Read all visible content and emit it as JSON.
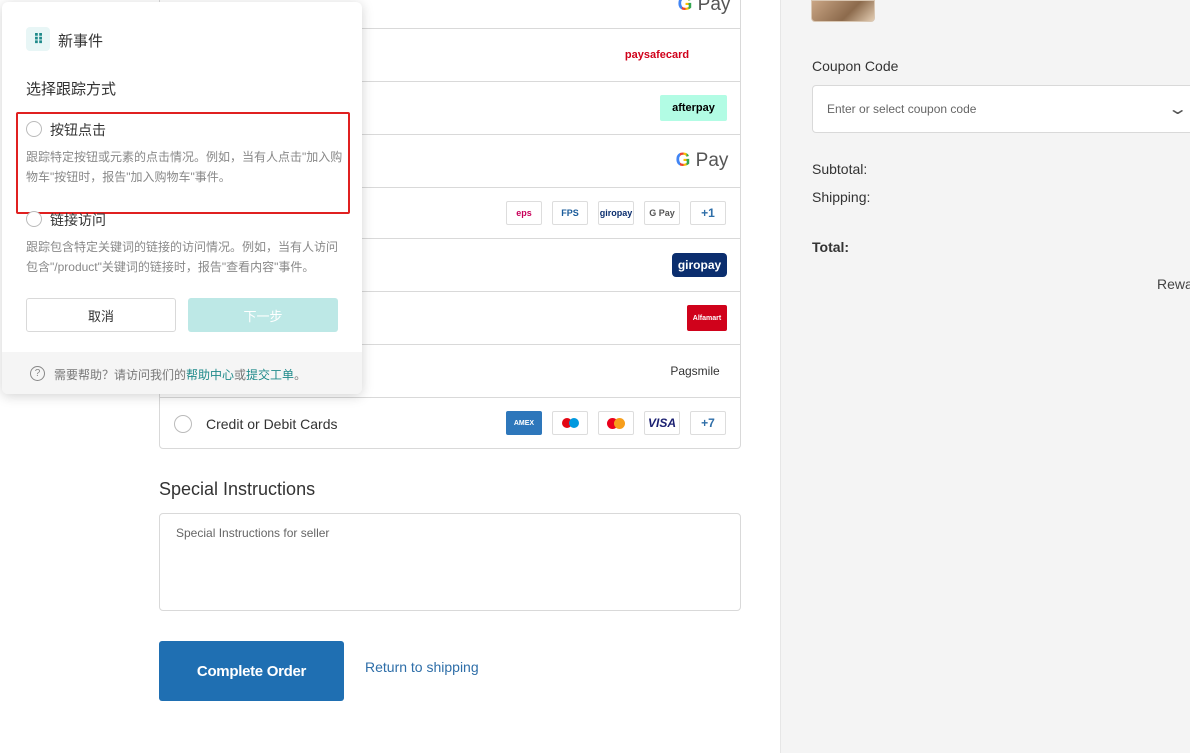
{
  "payment": {
    "methods": [
      {
        "label": "",
        "logo": "Pay"
      },
      {
        "label": "",
        "logo": "paysafecard"
      },
      {
        "label": "",
        "logo": "afterpay"
      },
      {
        "label": "",
        "logo": "Pay"
      },
      {
        "label": "",
        "logos": [
          "eps",
          "FPS",
          "giropay",
          "G Pay"
        ],
        "more": "+1"
      },
      {
        "label": "",
        "logo": "giropay"
      },
      {
        "label": "",
        "logo": "Alfamart"
      },
      {
        "label": "",
        "logo": "Pagsmile"
      },
      {
        "label": "Credit or Debit Cards",
        "logos": [
          "AMEX",
          "maestro",
          "mastercard",
          "VISA"
        ],
        "more": "+7"
      }
    ]
  },
  "special_instructions": {
    "title": "Special Instructions",
    "placeholder": "Special Instructions for seller"
  },
  "actions": {
    "complete_order": "Complete Order",
    "return_link": "Return to shipping"
  },
  "summary": {
    "coupon_label": "Coupon Code",
    "coupon_placeholder": "Enter or select coupon code",
    "subtotal_label": "Subtotal:",
    "shipping_label": "Shipping:",
    "total_label": "Total:",
    "reward_label": "Rewa"
  },
  "popup": {
    "title": "新事件",
    "section_title": "选择跟踪方式",
    "options": [
      {
        "label": "按钮点击",
        "desc": "跟踪特定按钮或元素的点击情况。例如，当有人点击\"加入购物车\"按钮时，报告\"加入购物车\"事件。"
      },
      {
        "label": "链接访问",
        "desc": "跟踪包含特定关键词的链接的访问情况。例如，当有人访问包含\"/product\"关键词的链接时，报告\"查看内容\"事件。"
      }
    ],
    "cancel": "取消",
    "next": "下一步",
    "help_prefix": "需要帮助？请访问我们的",
    "help_center": "帮助中心",
    "help_or": "或",
    "submit_ticket": "提交工单",
    "help_suffix": "。"
  },
  "colors": {
    "primary_button": "#1f6fb2",
    "teal_accent": "#1f8a8a",
    "highlight": "#e02020"
  }
}
